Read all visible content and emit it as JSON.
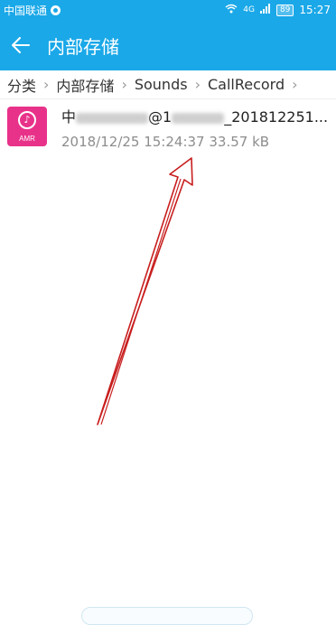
{
  "status_bar": {
    "carrier": "中国联通",
    "network": "4G",
    "battery": "89",
    "time": "15:27"
  },
  "header": {
    "title": "内部存储"
  },
  "breadcrumb": {
    "items": [
      "分类",
      "内部存储",
      "Sounds",
      "CallRecord"
    ]
  },
  "files": [
    {
      "name_prefix": "中",
      "name_middle": "@1",
      "name_suffix": "_201812251...",
      "icon_ext": "AMR",
      "date": "2018/12/25 15:24:37",
      "size": "33.57 kB"
    }
  ],
  "colors": {
    "header_bg": "#1aa8e8",
    "amr_icon_bg": "#e8328a",
    "annotation_arrow": "#c81e1e"
  }
}
